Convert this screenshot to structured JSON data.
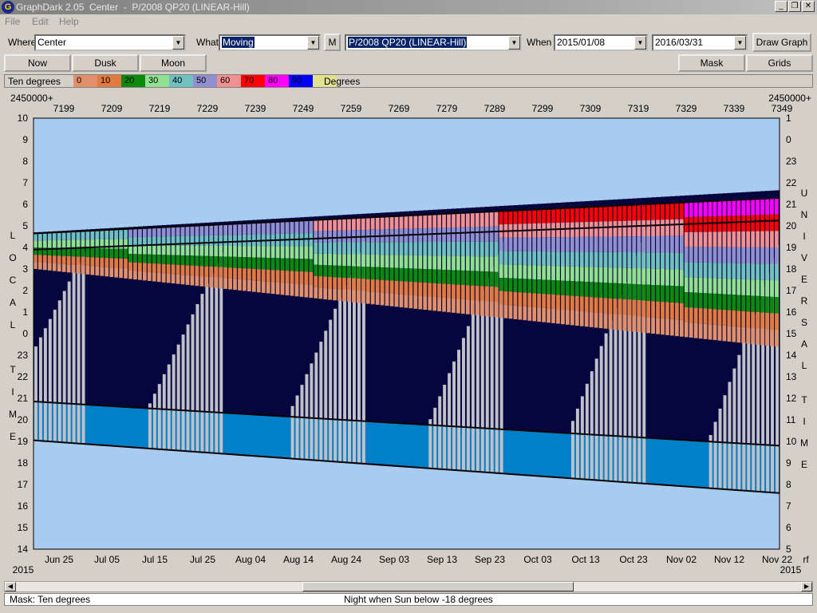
{
  "window": {
    "title": "GraphDark 2.05  Center  -  P/2008 QP20 (LINEAR-Hill)",
    "minimize": "_",
    "restore": "❐",
    "close": "✕"
  },
  "menu": [
    "File",
    "Edit",
    "Help"
  ],
  "toolbar": {
    "where_label": "Where",
    "where_value": "Center",
    "what_label": "What",
    "what_value": "Moving",
    "m_button": "M",
    "object_value": "P/2008 QP20 (LINEAR-Hill)",
    "when_label": "When",
    "start_date": "2015/01/08",
    "end_date": "2016/03/31",
    "draw_button": "Draw Graph"
  },
  "buttons_row": {
    "now": "Now",
    "dusk": "Dusk",
    "moon": "Moon",
    "mask": "Mask",
    "grids": "Grids"
  },
  "legend": {
    "title": "Ten degrees",
    "label": "Degrees",
    "segments": [
      {
        "value": "0",
        "color": "#e0906a"
      },
      {
        "value": "10",
        "color": "#e07a40"
      },
      {
        "value": "20",
        "color": "#0a8a0a"
      },
      {
        "value": "30",
        "color": "#90e090"
      },
      {
        "value": "40",
        "color": "#70c0c0"
      },
      {
        "value": "50",
        "color": "#9090d0"
      },
      {
        "value": "60",
        "color": "#f09090"
      },
      {
        "value": "70",
        "color": "#ff0000"
      },
      {
        "value": "80",
        "color": "#ff00ff"
      },
      {
        "value": "90",
        "color": "#0000ff"
      },
      {
        "value": "",
        "color": "#e0e090"
      }
    ]
  },
  "graph": {
    "jd_prefix_left": "2450000+",
    "jd_prefix_right": "2450000+",
    "jd_ticks": [
      "7199",
      "7209",
      "7219",
      "7229",
      "7239",
      "7249",
      "7259",
      "7269",
      "7279",
      "7289",
      "7299",
      "7309",
      "7319",
      "7329",
      "7339",
      "7349"
    ],
    "date_ticks": [
      "Jun 25",
      "Jul 05",
      "Jul 15",
      "Jul 25",
      "Aug 04",
      "Aug 14",
      "Aug 24",
      "Sep 03",
      "Sep 13",
      "Sep 23",
      "Oct 03",
      "Oct 13",
      "Oct 23",
      "Nov 02",
      "Nov 12",
      "Nov 22"
    ],
    "year_left": "2015",
    "year_right": "2015",
    "rf_label": "rf",
    "local_time_ticks": [
      "10",
      "9",
      "8",
      "7",
      "6",
      "5",
      "4",
      "3",
      "2",
      "1",
      "0",
      "23",
      "22",
      "21",
      "20",
      "19",
      "18",
      "17",
      "16",
      "15",
      "14"
    ],
    "universal_time_ticks": [
      "1",
      "0",
      "23",
      "22",
      "21",
      "20",
      "19",
      "18",
      "17",
      "16",
      "15",
      "14",
      "13",
      "12",
      "11",
      "10",
      "9",
      "8",
      "7",
      "6",
      "5"
    ],
    "left_axis_title": [
      "L",
      "O",
      "C",
      "A",
      "L",
      "",
      "T",
      "I",
      "M",
      "E"
    ],
    "right_axis_title_universal": [
      "U",
      "N",
      "I",
      "V",
      "E",
      "R",
      "S",
      "A",
      "L"
    ],
    "right_axis_title_time": [
      "T",
      "I",
      "M",
      "E"
    ],
    "colors": {
      "day": "#a8ccf0",
      "night": "#06063e",
      "twilight": "#0080c8",
      "moon": "#c0c0c8"
    }
  },
  "status": {
    "mask": "Mask:  Ten degrees",
    "night": "Night when Sun below -18 degrees"
  }
}
